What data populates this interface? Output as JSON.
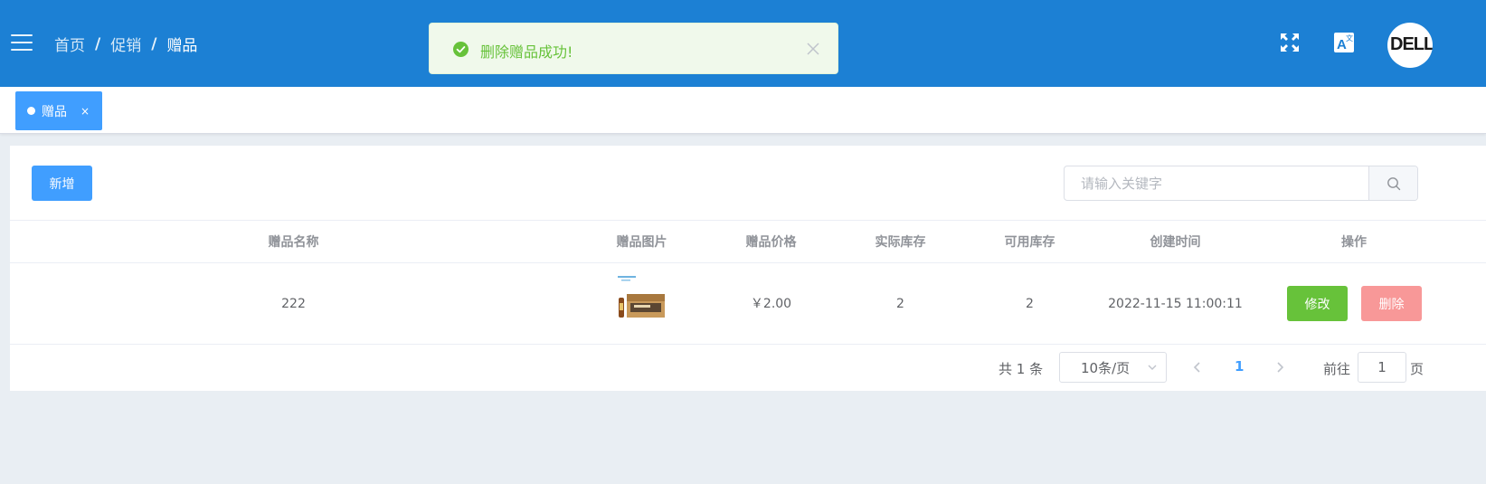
{
  "header": {
    "breadcrumb": [
      "首页",
      "促销",
      "赠品"
    ],
    "separator": "/",
    "avatar_text": "DELL"
  },
  "toast": {
    "message": "删除赠品成功!",
    "type": "success",
    "color": "#67c23a"
  },
  "tags": [
    {
      "label": "赠品",
      "close": "×",
      "active": true
    }
  ],
  "toolbar": {
    "add_label": "新增",
    "search_placeholder": "请输入关键字"
  },
  "table": {
    "columns": [
      "赠品名称",
      "赠品图片",
      "赠品价格",
      "实际库存",
      "可用库存",
      "创建时间",
      "操作"
    ],
    "rows": [
      {
        "name": "222",
        "image": "product-thumbnail",
        "price": "￥2.00",
        "actual_stock": "2",
        "available_stock": "2",
        "created_at": "2022-11-15 11:00:11",
        "edit_label": "修改",
        "delete_label": "删除"
      }
    ]
  },
  "pagination": {
    "total": "共 1 条",
    "page_size": "10条/页",
    "current_page": "1",
    "goto_label": "前往",
    "goto_value": "1",
    "goto_suffix": "页"
  },
  "colors": {
    "header_bg": "#1c80d4",
    "primary": "#409eff",
    "success": "#67c23a",
    "danger_light": "#f89898"
  },
  "icons": {
    "menu": "hamburger-icon",
    "fullscreen": "fullscreen-icon",
    "language": "translate-icon",
    "toast": "check-circle-icon",
    "search": "search-icon"
  }
}
